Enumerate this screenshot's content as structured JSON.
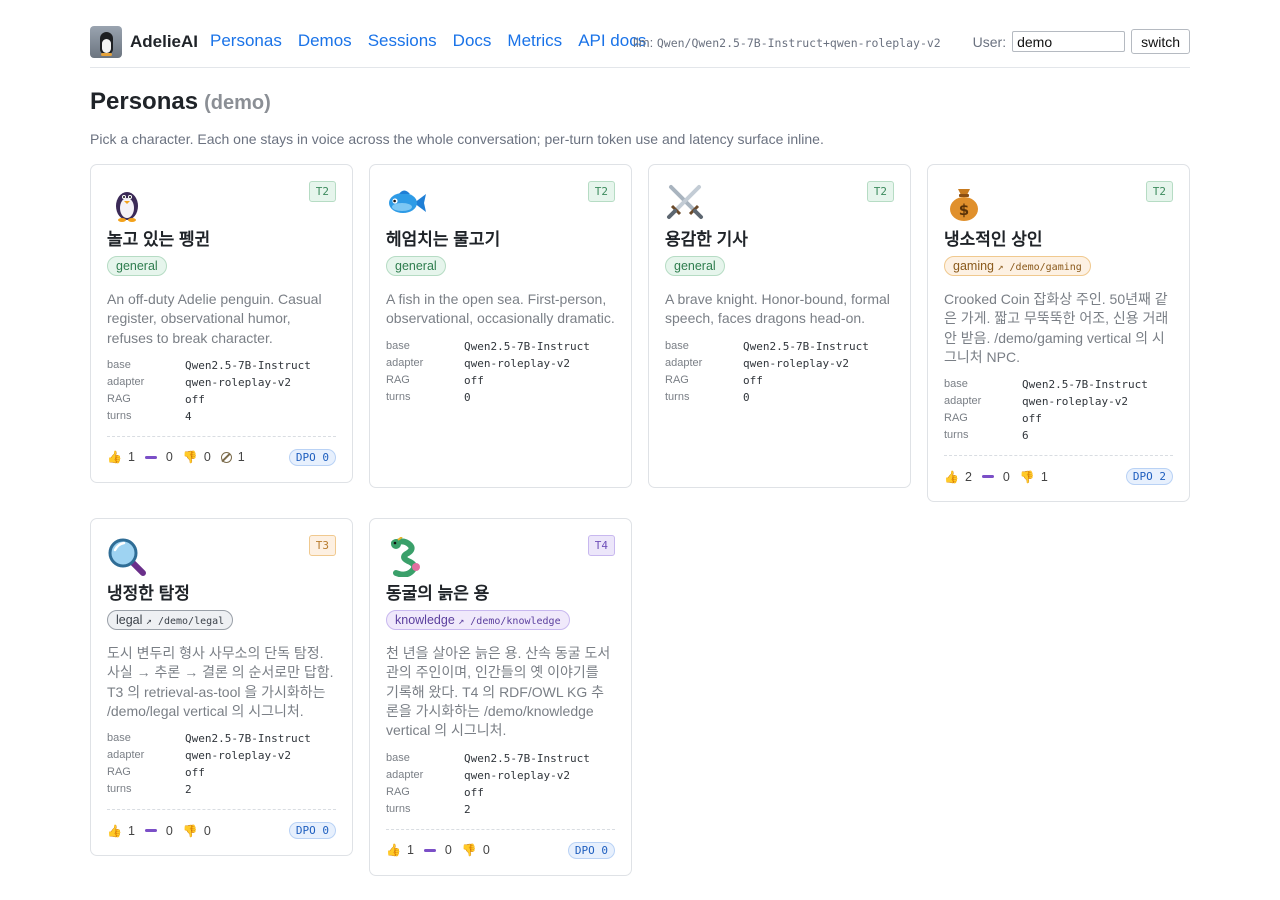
{
  "header": {
    "brand": "AdelieAI",
    "nav": [
      "Personas",
      "Demos",
      "Sessions",
      "Docs",
      "Metrics",
      "API docs"
    ],
    "llm_label": "llm:",
    "llm_value": "Qwen/Qwen2.5-7B-Instruct+qwen-roleplay-v2",
    "user_label": "User:",
    "user_value": "demo",
    "switch_label": "switch"
  },
  "page": {
    "title": "Personas",
    "title_sub": "(demo)",
    "intro": "Pick a character. Each one stays in voice across the whole conversation; per-turn token use and latency surface inline."
  },
  "meta_labels": {
    "base": "base",
    "adapter": "adapter",
    "rag": "RAG",
    "turns": "turns"
  },
  "personas": [
    {
      "tier": "T2",
      "icon": "penguin-icon",
      "name": "놀고 있는 펭귄",
      "tag": "general",
      "tag_path": "",
      "desc": "An off-duty Adelie penguin. Casual register, observational humor, refuses to break character.",
      "base": "Qwen2.5-7B-Instruct",
      "adapter": "qwen-roleplay-v2",
      "rag": "off",
      "turns": "4",
      "feedback": {
        "up": "1",
        "neutral": "0",
        "down": "0",
        "skip": "1"
      },
      "dpo": "DPO 0"
    },
    {
      "tier": "T2",
      "icon": "fish-icon",
      "name": "헤엄치는 물고기",
      "tag": "general",
      "tag_path": "",
      "desc": "A fish in the open sea. First-person, observational, occasionally dramatic.",
      "base": "Qwen2.5-7B-Instruct",
      "adapter": "qwen-roleplay-v2",
      "rag": "off",
      "turns": "0",
      "feedback": null,
      "dpo": ""
    },
    {
      "tier": "T2",
      "icon": "crossed-swords-icon",
      "name": "용감한 기사",
      "tag": "general",
      "tag_path": "",
      "desc": "A brave knight. Honor-bound, formal speech, faces dragons head-on.",
      "base": "Qwen2.5-7B-Instruct",
      "adapter": "qwen-roleplay-v2",
      "rag": "off",
      "turns": "0",
      "feedback": null,
      "dpo": ""
    },
    {
      "tier": "T2",
      "icon": "money-bag-icon",
      "name": "냉소적인 상인",
      "tag": "gaming",
      "tag_path": "↗ /demo/gaming",
      "desc": "Crooked Coin 잡화상 주인. 50년째 같은 가게. 짧고 무뚝뚝한 어조, 신용 거래 안 받음. /demo/gaming vertical 의 시그니처 NPC.",
      "base": "Qwen2.5-7B-Instruct",
      "adapter": "qwen-roleplay-v2",
      "rag": "off",
      "turns": "6",
      "feedback": {
        "up": "2",
        "neutral": "0",
        "down": "1",
        "skip": ""
      },
      "dpo": "DPO 2"
    },
    {
      "tier": "T3",
      "icon": "magnifier-icon",
      "name": "냉정한 탐정",
      "tag": "legal",
      "tag_path": "↗ /demo/legal",
      "desc": "도시 변두리 형사 사무소의 단독 탐정. 사실 → 추론 → 결론 의 순서로만 답함. T3 의 retrieval-as-tool 을 가시화하는 /demo/legal vertical 의 시그니처.",
      "base": "Qwen2.5-7B-Instruct",
      "adapter": "qwen-roleplay-v2",
      "rag": "off",
      "turns": "2",
      "feedback": {
        "up": "1",
        "neutral": "0",
        "down": "0",
        "skip": ""
      },
      "dpo": "DPO 0"
    },
    {
      "tier": "T4",
      "icon": "dragon-icon",
      "name": "동굴의 늙은 용",
      "tag": "knowledge",
      "tag_path": "↗ /demo/knowledge",
      "desc": "천 년을 살아온 늙은 용. 산속 동굴 도서관의 주인이며, 인간들의 옛 이야기를 기록해 왔다. T4 의 RDF/OWL KG 추론을 가시화하는 /demo/knowledge vertical 의 시그니처.",
      "base": "Qwen2.5-7B-Instruct",
      "adapter": "qwen-roleplay-v2",
      "rag": "off",
      "turns": "2",
      "feedback": {
        "up": "1",
        "neutral": "0",
        "down": "0",
        "skip": ""
      },
      "dpo": "DPO 0"
    }
  ]
}
